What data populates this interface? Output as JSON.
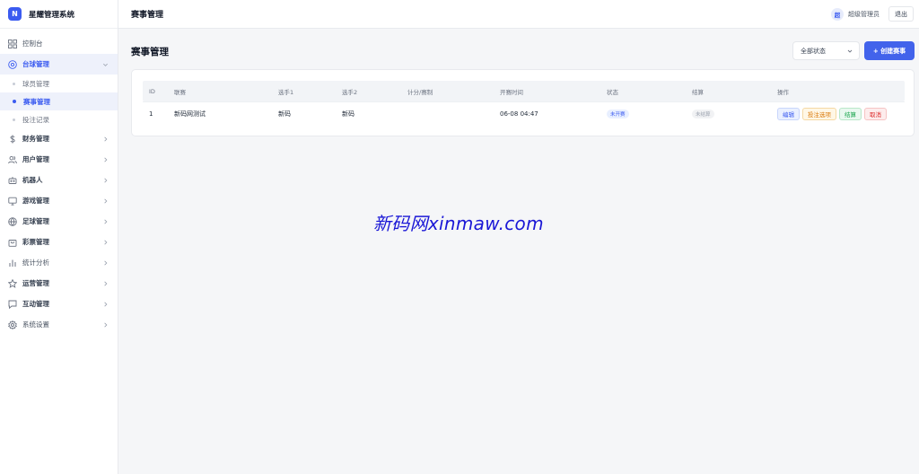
{
  "brand": {
    "logo_letter": "N",
    "name": "星耀管理系统"
  },
  "sidebar": {
    "items": [
      {
        "label": "控制台"
      },
      {
        "label": "台球管理",
        "children": [
          "球员管理",
          "赛事管理",
          "投注记录"
        ]
      },
      {
        "label": "财务管理"
      },
      {
        "label": "用户管理"
      },
      {
        "label": "机器人"
      },
      {
        "label": "游戏管理"
      },
      {
        "label": "足球管理"
      },
      {
        "label": "彩票管理"
      },
      {
        "label": "统计分析"
      },
      {
        "label": "运营管理"
      },
      {
        "label": "互动管理"
      },
      {
        "label": "系统设置"
      }
    ]
  },
  "topbar": {
    "title": "赛事管理",
    "avatar_text": "超",
    "user_name": "超级管理员",
    "logout_label": "退出"
  },
  "main": {
    "page_title": "赛事管理",
    "status_filter": "全部状态",
    "create_button": "+ 创建赛事"
  },
  "table": {
    "headers": [
      "ID",
      "联赛",
      "选手1",
      "选手2",
      "计分/赛制",
      "开赛时间",
      "状态",
      "结算",
      "操作"
    ],
    "rows": [
      {
        "id": "1",
        "league": "新码网测试",
        "player1": "新码",
        "player2": "新码",
        "scoring": "",
        "start_time": "06-08 04:47",
        "status": "未开赛",
        "settlement": "未结算",
        "actions": [
          "编辑",
          "投注选项",
          "结算",
          "取消"
        ]
      }
    ]
  },
  "watermark": "新码网xinmaw.com",
  "colors": {
    "accent": "#4263eb",
    "sidebar_active_bg": "#eef1fb",
    "watermark": "#1a17d6"
  }
}
